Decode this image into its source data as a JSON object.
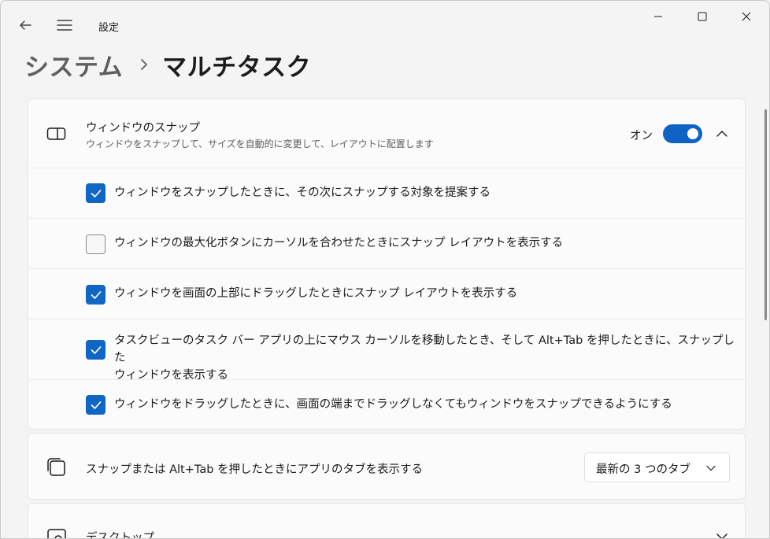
{
  "window": {
    "app_title": "設定",
    "caption": {
      "minimize_icon": "minimize-icon",
      "maximize_icon": "maximize-icon",
      "close_icon": "close-icon"
    }
  },
  "breadcrumb": {
    "parent": "システム",
    "current": "マルチタスク"
  },
  "snap_section": {
    "title": "ウィンドウのスナップ",
    "description": "ウィンドウをスナップして、サイズを自動的に変更して、レイアウトに配置します",
    "toggle_label": "オン",
    "toggle_on": true,
    "expanded": true,
    "options": [
      {
        "label": "ウィンドウをスナップしたときに、その次にスナップする対象を提案する",
        "checked": true
      },
      {
        "label": "ウィンドウの最大化ボタンにカーソルを合わせたときにスナップ レイアウトを表示する",
        "checked": false
      },
      {
        "label": "ウィンドウを画面の上部にドラッグしたときにスナップ レイアウトを表示する",
        "checked": true
      },
      {
        "label_line1": "タスクビューのタスク バー アプリの上にマウス カーソルを移動したとき、そして Alt+Tab を押したときに、スナップした",
        "label_line2": "ウィンドウを表示する",
        "checked": true
      },
      {
        "label": "ウィンドウをドラッグしたときに、画面の端までドラッグしなくてもウィンドウをスナップできるようにする",
        "checked": true
      }
    ]
  },
  "alt_tab_section": {
    "title": "スナップまたは Alt+Tab を押したときにアプリのタブを表示する",
    "selected_value": "最新の 3 つのタブ"
  },
  "desktop_section": {
    "title": "デスクトップ"
  },
  "colors": {
    "accent": "#0f63c4",
    "card": "#fbfbfb",
    "background": "#f4f4f4"
  }
}
